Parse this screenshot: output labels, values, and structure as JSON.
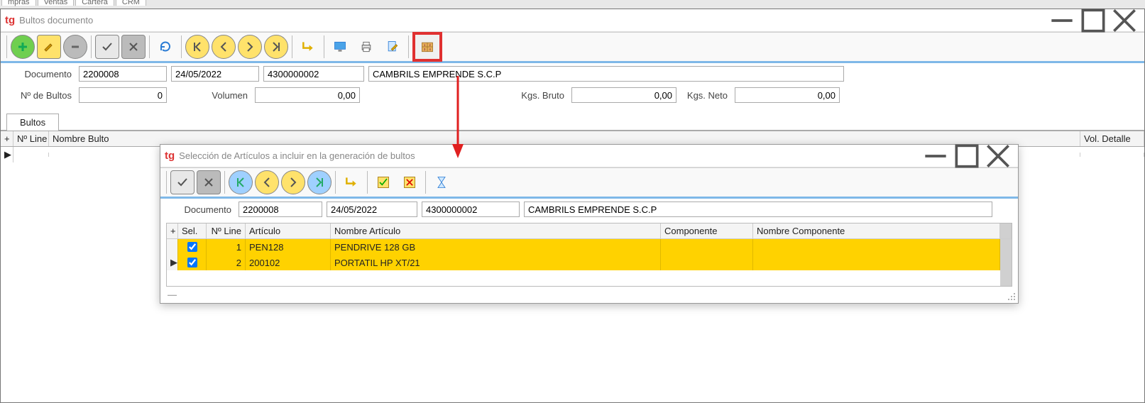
{
  "outer_tabs": [
    "mpras",
    "Ventas",
    "Cartera",
    "CRM"
  ],
  "main": {
    "title": "Bultos documento",
    "doc_label": "Documento",
    "doc_number": "2200008",
    "doc_date": "24/05/2022",
    "doc_code": "4300000002",
    "doc_name": "CAMBRILS EMPRENDE S.C.P",
    "bultos_label": "Nº de Bultos",
    "bultos_value": "0",
    "volumen_label": "Volumen",
    "volumen_value": "0,00",
    "kgs_bruto_label": "Kgs. Bruto",
    "kgs_bruto_value": "0,00",
    "kgs_neto_label": "Kgs. Neto",
    "kgs_neto_value": "0,00",
    "tab_bultos": "Bultos",
    "grid_headers": [
      "+",
      "Nº Line",
      "Nombre Bulto",
      "Vol. Detalle"
    ]
  },
  "sub": {
    "title": "Selección de Artículos a incluir en la generación de bultos",
    "doc_label": "Documento",
    "doc_number": "2200008",
    "doc_date": "24/05/2022",
    "doc_code": "4300000002",
    "doc_name": "CAMBRILS EMPRENDE S.C.P",
    "headers": [
      "+",
      "Sel.",
      "Nº Line",
      "Artículo",
      "Nombre Artículo",
      "Componente",
      "Nombre Componente"
    ],
    "rows": [
      {
        "marker": "",
        "sel": true,
        "line": "1",
        "articulo": "PEN128",
        "nombre": "PENDRIVE 128 GB",
        "componente": "",
        "nombre_componente": ""
      },
      {
        "marker": "▶",
        "sel": true,
        "line": "2",
        "articulo": "200102",
        "nombre": "PORTATIL HP XT/21",
        "componente": "",
        "nombre_componente": ""
      }
    ]
  }
}
